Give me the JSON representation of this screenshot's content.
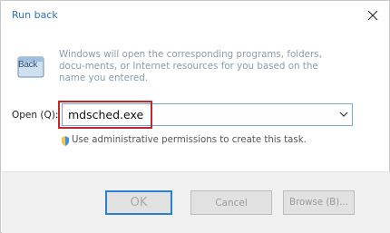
{
  "window": {
    "title": "Run back"
  },
  "icon": {
    "label": "Back"
  },
  "description": "Windows will open the corresponding programs, folders, docu-ments, or Internet resources for you based on the name you entered.",
  "open_field": {
    "label": "Open (Q):",
    "value": "mdsched.exe"
  },
  "admin_note": "Use administrative permissions to create this task.",
  "buttons": {
    "ok": "OK",
    "cancel": "Cancel",
    "browse": "Browse (B)..."
  },
  "colors": {
    "highlight": "#c1272d",
    "accent": "#2f7fd0"
  }
}
